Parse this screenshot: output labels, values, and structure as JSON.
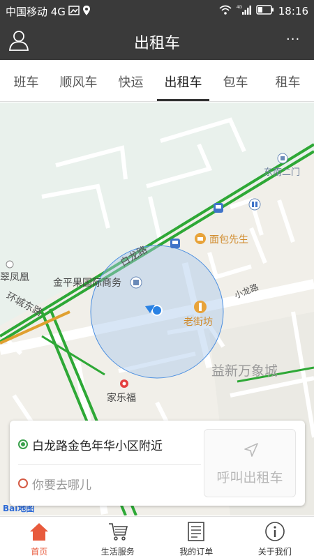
{
  "status_bar": {
    "carrier": "中国移动 4G",
    "network": "4G",
    "time": "18:16"
  },
  "header": {
    "title": "出租车",
    "more": "···"
  },
  "tabs": [
    {
      "label": "班车"
    },
    {
      "label": "顺风车"
    },
    {
      "label": "快运"
    },
    {
      "label": "出租车",
      "active": true
    },
    {
      "label": "包车"
    },
    {
      "label": "租车"
    }
  ],
  "map": {
    "labels": {
      "dongnan_ermen": "东南二门",
      "mianbao": "面包先生",
      "bailong_road": "白龙路",
      "cuifenghuang": "翠凤凰",
      "jinpingguo": "金平果国际商务",
      "huancheng": "环城东路",
      "xiaolong": "小龙路",
      "laojiefang": "老街坊",
      "yixin": "益新万象城",
      "jialefu": "家乐福"
    },
    "logo": "Bai地图"
  },
  "card": {
    "origin": "白龙路金色年华小区附近",
    "destination_placeholder": "你要去哪儿",
    "call_label": "呼叫出租车"
  },
  "bottom_nav": [
    {
      "label": "首页",
      "icon": "home-icon",
      "active": true
    },
    {
      "label": "生活服务",
      "icon": "cart-icon"
    },
    {
      "label": "我的订单",
      "icon": "order-list-icon"
    },
    {
      "label": "关于我们",
      "icon": "info-icon"
    }
  ],
  "colors": {
    "header_bg": "#3a3a3a",
    "accent": "#e85a3c",
    "road_green": "#2ea836",
    "circle": "#4a8ee0"
  }
}
